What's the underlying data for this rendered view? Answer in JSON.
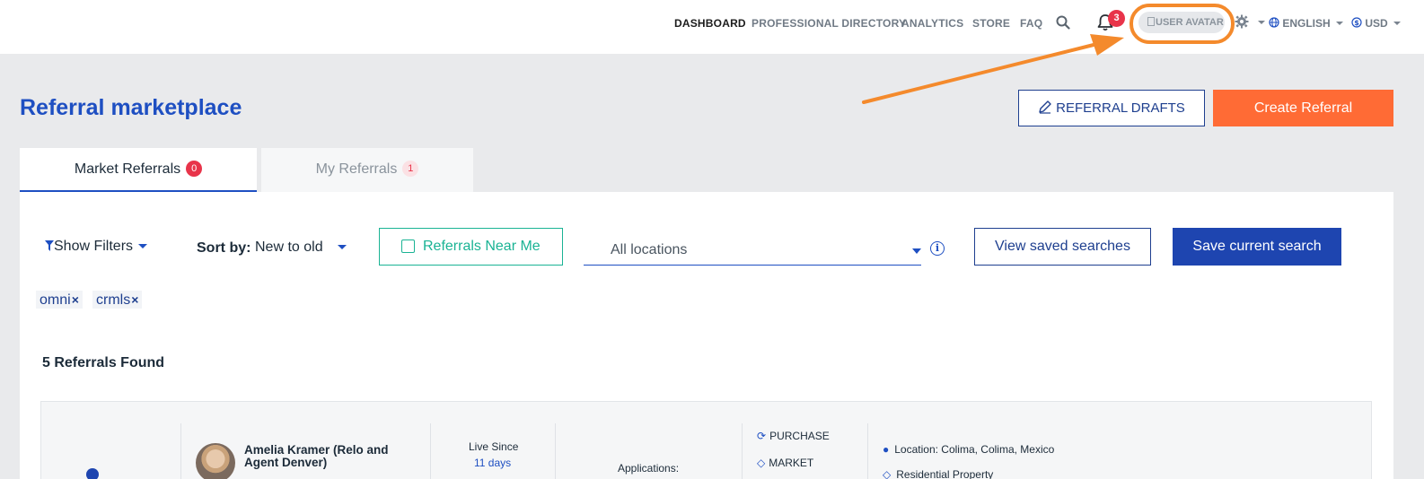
{
  "nav": {
    "links": [
      "DASHBOARD",
      "PROFESSIONAL DIRECTORY",
      "ANALYTICS",
      "STORE",
      "FAQ"
    ],
    "notification_count": "3",
    "avatar_alt": "USER AVATAR",
    "language": "ENGLISH",
    "currency": "USD"
  },
  "page": {
    "title": "Referral marketplace",
    "drafts_button": "REFERRAL DRAFTS",
    "create_button": "Create Referral"
  },
  "tabs": [
    {
      "label": "Market Referrals",
      "count": "0"
    },
    {
      "label": "My Referrals",
      "count": "1"
    }
  ],
  "filters": {
    "show_filters": "Show Filters",
    "sort_label": "Sort by:",
    "sort_value": "New to old",
    "near_me": "Referrals Near Me",
    "locations": "All locations",
    "view_saved": "View saved searches",
    "save_current": "Save current search",
    "chips": [
      "omni",
      "crmls"
    ]
  },
  "results": {
    "count_text": "5 Referrals Found"
  },
  "card": {
    "agent_name": "Amelia Kramer (Relo and Agent Denver)",
    "live_since_label": "Live Since",
    "live_since_value": "11 days",
    "applications_label": "Applications:",
    "type_purchase": "PURCHASE",
    "type_market": "MARKET",
    "location": "Location: Colima, Colima, Mexico",
    "property_type": "Residential Property"
  },
  "colors": {
    "brand_blue": "#1e4fc2",
    "accent_orange": "#ff6b35",
    "teal": "#1ab394",
    "badge_red": "#e8344a",
    "annotation_orange": "#f48a2c"
  }
}
